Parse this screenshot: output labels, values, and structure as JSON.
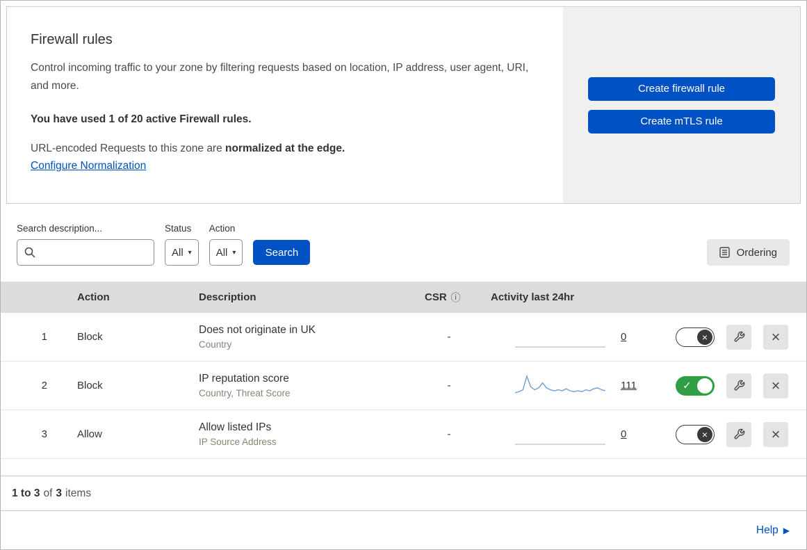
{
  "header": {
    "title": "Firewall rules",
    "description": "Control incoming traffic to your zone by filtering requests based on location, IP address, user agent, URI, and more.",
    "usage": "You have used 1 of 20 active Firewall rules.",
    "normalization": {
      "prefix": "URL-encoded Requests to this zone are ",
      "bold": "normalized at the edge."
    },
    "configure_link": "Configure Normalization",
    "create_firewall_button": "Create firewall rule",
    "create_mtls_button": "Create mTLS rule"
  },
  "filters": {
    "search_label": "Search description...",
    "search_value": "",
    "status_label": "Status",
    "status_value": "All",
    "action_label": "Action",
    "action_value": "All",
    "search_button": "Search",
    "ordering_button": "Ordering"
  },
  "table": {
    "columns": {
      "action": "Action",
      "description": "Description",
      "csr": "CSR",
      "activity": "Activity last 24hr"
    },
    "rows": [
      {
        "num": "1",
        "action": "Block",
        "description": "Does not originate in UK",
        "criteria": "Country",
        "csr": "-",
        "activity_count": "0",
        "enabled": false,
        "sparkline": [
          0,
          0,
          0,
          0,
          0,
          0,
          0,
          0,
          0,
          0,
          0,
          0,
          0,
          0,
          0,
          0,
          0,
          0,
          0,
          0
        ],
        "spark_color": "#cfc9c2"
      },
      {
        "num": "2",
        "action": "Block",
        "description": "IP reputation score",
        "criteria": "Country, Threat Score",
        "csr": "-",
        "activity_count": "111",
        "enabled": true,
        "sparkline": [
          3,
          4,
          6,
          20,
          9,
          6,
          8,
          13,
          8,
          6,
          5,
          6,
          5,
          7,
          5,
          4,
          5,
          4,
          6,
          5,
          7,
          8,
          6,
          5
        ],
        "spark_color": "#6d9fd8"
      },
      {
        "num": "3",
        "action": "Allow",
        "description": "Allow listed IPs",
        "criteria": "IP Source Address",
        "csr": "-",
        "activity_count": "0",
        "enabled": false,
        "sparkline": [
          0,
          0,
          0,
          0,
          0,
          0,
          0,
          0,
          0,
          0,
          0,
          0,
          0,
          0,
          0,
          0,
          0,
          0,
          0,
          0
        ],
        "spark_color": "#cfc9c2"
      }
    ],
    "footer": {
      "range": "1 to 3",
      "of_text": "of",
      "total": "3",
      "items_text": "items"
    }
  },
  "help": {
    "label": "Help"
  },
  "colors": {
    "primary_blue": "#0051c3",
    "toggle_green": "#2f9e44"
  }
}
